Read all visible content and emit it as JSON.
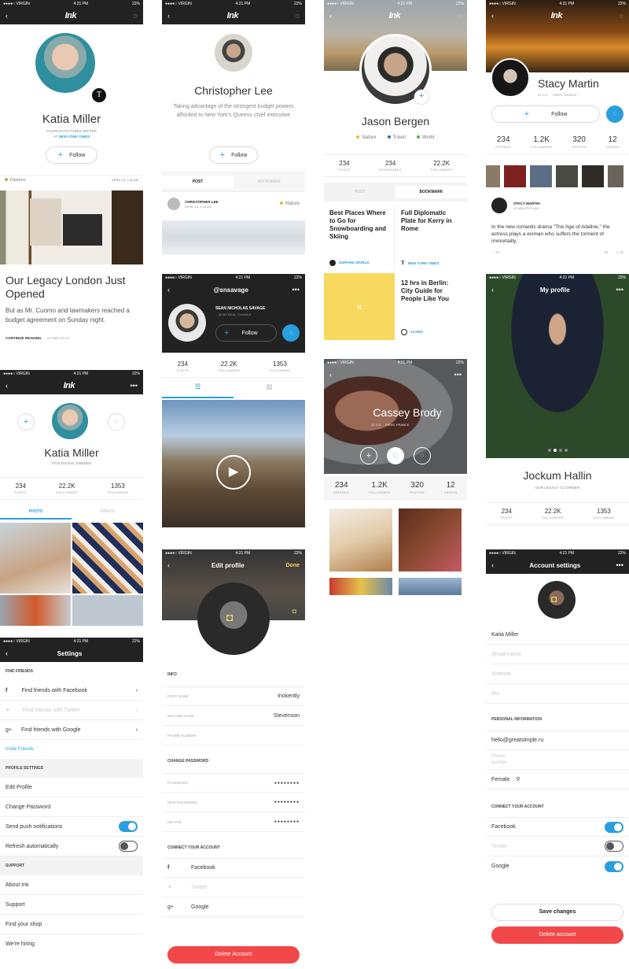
{
  "status": {
    "carrier": "●●●●○ VIRGIN",
    "time": "4:21 PM",
    "battery": "22%"
  },
  "brand": "Ink",
  "s1": {
    "name": "Katia Miller",
    "role": "FASHION FEATURES WRITER",
    "org_prefix": "AT",
    "org": "NEW YORK TIMES",
    "follow": "Follow",
    "category": "Fashion",
    "date": "APRIL 14, 7:32 AM",
    "headline": "Our Legacy London Just Opened",
    "body": "But as Mr. Cuomo and lawmakers reached a budget agreement on Sunday night.",
    "cta": "CONTINUE READING",
    "read_time": "12 MIN READ"
  },
  "s2": {
    "name": "Christopher Lee",
    "bio": "Taking advantage of the strongest budget powers afforded to New York's Queens chief executive",
    "follow": "Follow",
    "tab_post": "POST",
    "tab_bookmark": "BOOKMARK",
    "author": "CHRISTOPHER LEE",
    "date": "APRIL 14, 3:15 AM",
    "tag": "Nature"
  },
  "s3": {
    "name": "Jason Bergen",
    "tags": [
      {
        "label": "Nature",
        "color": "#f0b72f"
      },
      {
        "label": "Travel",
        "color": "#2a6fd6"
      },
      {
        "label": "World",
        "color": "#4cb050"
      }
    ],
    "stats": [
      {
        "v": "234",
        "l": "POSTS"
      },
      {
        "v": "234",
        "l": "BOOKMARKS"
      },
      {
        "v": "22.2K",
        "l": "FOLLOWERS"
      }
    ],
    "tab_post": "POST",
    "tab_bookmark": "BOOKMARK",
    "card1_title": "Best Places Where to Go for Snowboarding and Skiing",
    "card1_src": "SURFING WORLD",
    "card2_title": "Full Diplomatic Plate for Kerry in Rome",
    "card2_src": "NEW YORK TIMES",
    "card3_title": "12 hrs in Berlin: City Guide for People Like You",
    "card3_src": "12 HRS"
  },
  "s4": {
    "name": "Stacy Martin",
    "meta": "24 Y.O.",
    "loc": "PARIS, FRANCE",
    "follow": "Follow",
    "stats": [
      {
        "v": "234",
        "l": "FRIENDS"
      },
      {
        "v": "1.2K",
        "l": "FOLLOWERS"
      },
      {
        "v": "320",
        "l": "PHOTOS"
      },
      {
        "v": "12",
        "l": "VIDEOS"
      }
    ],
    "author": "STACY MARTIN",
    "time": "42 MINUTES AGO",
    "text": "In the new romantic drama \"The Age of Adaline,\" the actress plays a woman who suffers the torment of immortality.",
    "likes": "24",
    "comments": "18",
    "shares": "12"
  },
  "s5": {
    "name": "Katia Miller",
    "loc": "STOCKHOLM, SWEDEN",
    "stats": [
      {
        "v": "234",
        "l": "POSTS"
      },
      {
        "v": "22.2K",
        "l": "FOLLOWERS"
      },
      {
        "v": "1353",
        "l": "FOLLOWING"
      }
    ],
    "tab_photo": "PHOTO",
    "tab_videos": "VIDEOS"
  },
  "s6": {
    "handle": "@snsavage",
    "name": "SEAN NICHOLAS SAVAGE",
    "loc": "MONTREAL, CANADA",
    "follow": "Follow",
    "stats": [
      {
        "v": "234",
        "l": "POSTS"
      },
      {
        "v": "22.2K",
        "l": "FOLLOWERS"
      },
      {
        "v": "1353",
        "l": "FOLLOWING"
      }
    ]
  },
  "s7": {
    "name": "Cassey Brody",
    "meta": "22 Y.O.",
    "loc": "PARIS, FRANCE",
    "stats": [
      {
        "v": "234",
        "l": "FRIENDS"
      },
      {
        "v": "1.2K",
        "l": "FOLLOWERS"
      },
      {
        "v": "320",
        "l": "PHOTOS"
      },
      {
        "v": "12",
        "l": "VIDEOS"
      }
    ]
  },
  "s8": {
    "title": "My profile",
    "name": "Jockum Hallin",
    "role": "OUR LEGACY CO OWNER",
    "stats": [
      {
        "v": "234",
        "l": "POSTS"
      },
      {
        "v": "22.2K",
        "l": "FOLLOWERS"
      },
      {
        "v": "1353",
        "l": "FOLLOWING"
      }
    ]
  },
  "s9": {
    "title": "Settings",
    "find_header": "FIND FRIENDS",
    "fb": "Find friends with Facebook",
    "tw": "Find friends with Twitter",
    "gp": "Find friends with Google",
    "invite": "Invite Friends",
    "profile_header": "PROFILE SETTINGS",
    "edit": "Edit Profile",
    "change_pw": "Change Password",
    "push": "Send push notifications",
    "refresh": "Refresh automatically",
    "support_header": "SUPPORT",
    "about": "About Ink",
    "support": "Support",
    "shop": "Find your shop",
    "hiring": "We're hiring"
  },
  "s10": {
    "title": "Edit profile",
    "done": "Done",
    "info": "INFO",
    "first_label": "FIRST NAME",
    "first_val": "Inokently",
    "second_label": "SECOND NAME",
    "second_val": "Stevenson",
    "phone_label": "PHONE NUMBER",
    "pw_header": "CHANGE PASSWORD",
    "pw_label": "PASSWORD",
    "new_pw_label": "NEW PASSWORD",
    "retype_label": "RETYPE",
    "dots": "●●●●●●●●",
    "connect": "CONNECT YOUR ACCOUNT",
    "fb": "Facebook",
    "tw": "Twitter",
    "gp": "Google",
    "delete": "Delete Account"
  },
  "s11": {
    "title": "Account settings",
    "name_val": "Katia Miller",
    "username_ph": "@username",
    "website_ph": "Website",
    "bio_ph": "Bio",
    "personal": "PERSONAL INFORMATION",
    "email": "hello@greatsimple.ru",
    "phone_ph": "Phone number",
    "gender": "Female",
    "connect": "CONNECT YOUR ACCOUNT",
    "fb": "Facebook",
    "tw": "Twitter",
    "gp": "Google",
    "save": "Save changes",
    "delete": "Delete account"
  },
  "colors": {
    "accent": "#2a9fe0",
    "danger": "#f2484a",
    "dark": "#222222",
    "yellow": "#f6d95e"
  }
}
